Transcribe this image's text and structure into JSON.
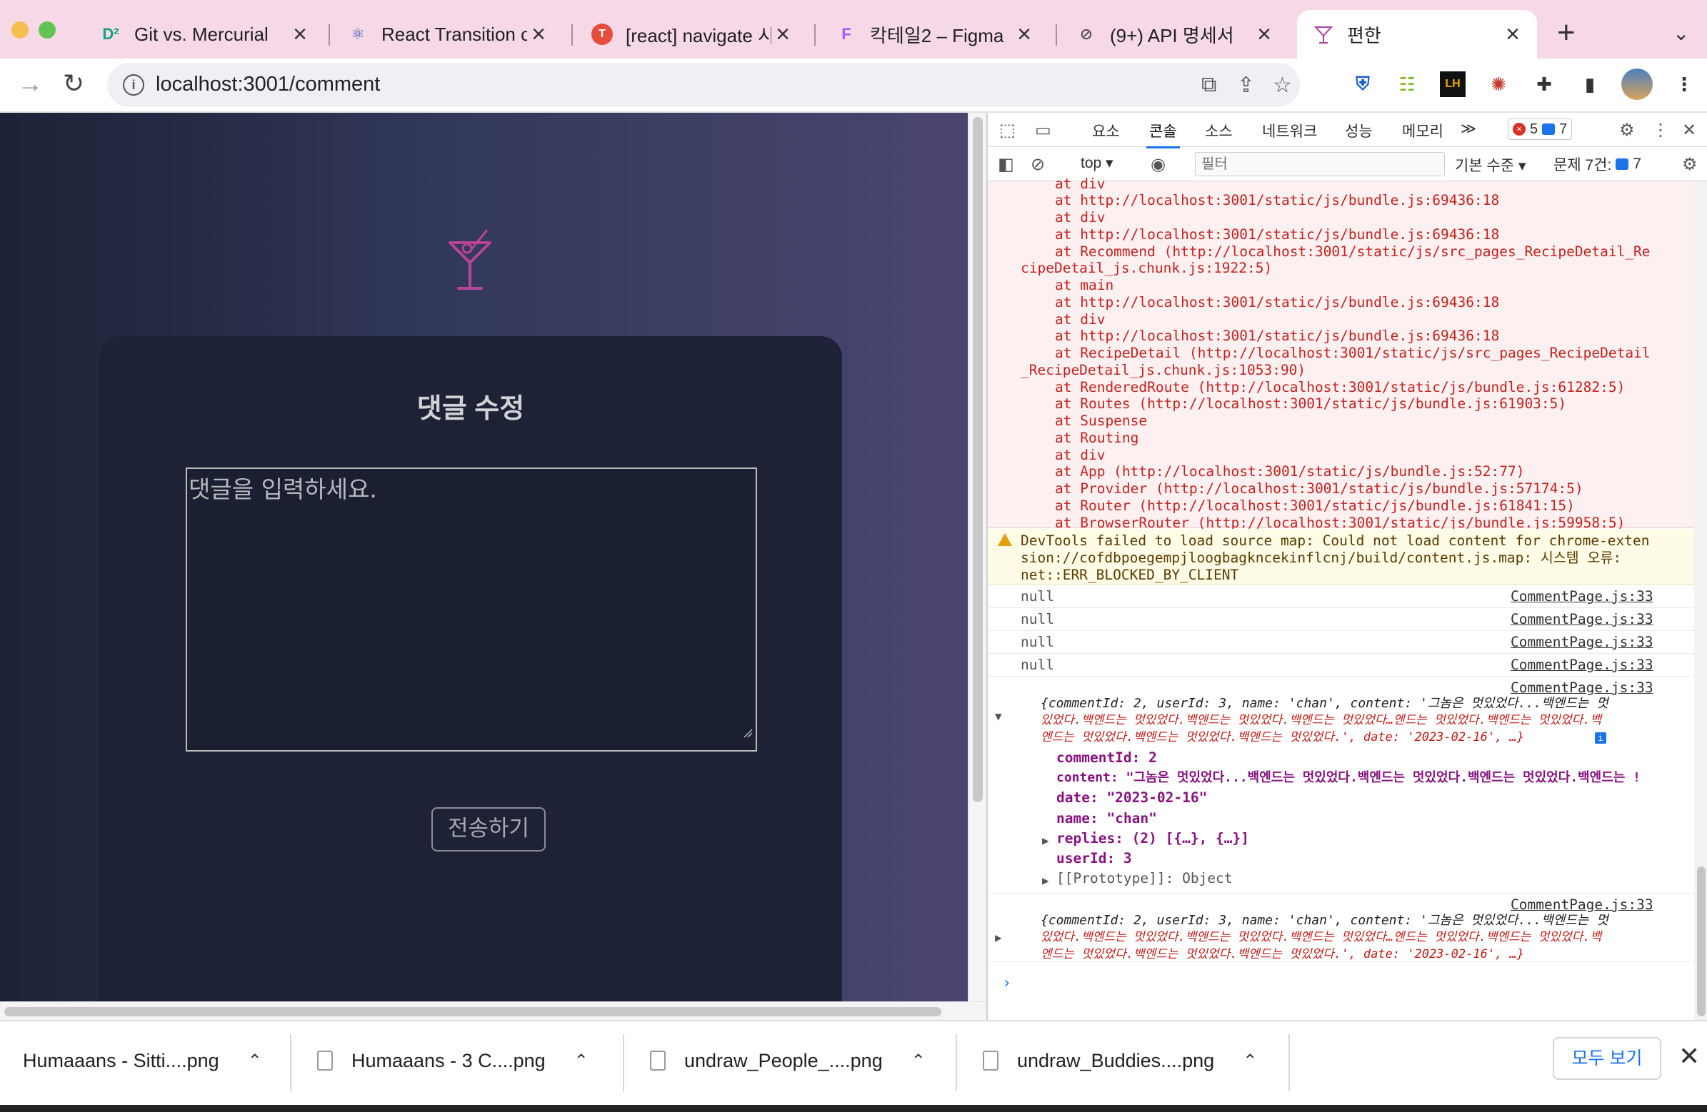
{
  "browser": {
    "tabs": [
      {
        "title": "Git vs. Mercurial",
        "favicon": "D²",
        "favicon_color": "#0fa37f"
      },
      {
        "title": "React Transition co",
        "favicon": "⚛",
        "favicon_color": "#3f51b5"
      },
      {
        "title": "[react] navigate 시",
        "favicon": "T",
        "favicon_color": "#e74c3c"
      },
      {
        "title": "칵테일2 – Figma",
        "favicon": "F",
        "favicon_color": "#a259ff"
      },
      {
        "title": "(9+) API 명세서",
        "favicon": "⊘",
        "favicon_color": "#555555"
      },
      {
        "title": "편한",
        "favicon": "🍸",
        "favicon_color": "#b040a0"
      }
    ],
    "url": "localhost:3001/comment"
  },
  "page": {
    "heading": "댓글 수정",
    "comment_placeholder": "댓글을 입력하세요.",
    "submit_label": "전송하기",
    "accent_color": "#b8449a"
  },
  "devtools": {
    "tabs": [
      "요소",
      "콘솔",
      "소스",
      "네트워크",
      "성능",
      "메모리"
    ],
    "more": "≫",
    "error_count": "5",
    "message_count": "7",
    "context": "top",
    "filter_placeholder": "필터",
    "level": "기본 수준 ▾",
    "issues_label": "문제 7건:",
    "issues_count": "7",
    "stack": [
      "at div",
      "at http://localhost:3001/static/js/bundle.js:69436:18",
      "at div",
      "at http://localhost:3001/static/js/bundle.js:69436:18",
      "at Recommend (http://localhost:3001/static/js/src_pages_RecipeDetail_Re",
      "cipeDetail_js.chunk.js:1922:5)",
      "at main",
      "at http://localhost:3001/static/js/bundle.js:69436:18",
      "at div",
      "at http://localhost:3001/static/js/bundle.js:69436:18",
      "at RecipeDetail (http://localhost:3001/static/js/src_pages_RecipeDetail",
      "_RecipeDetail_js.chunk.js:1053:90)",
      "at RenderedRoute (http://localhost:3001/static/js/bundle.js:61282:5)",
      "at Routes (http://localhost:3001/static/js/bundle.js:61903:5)",
      "at Suspense",
      "at Routing",
      "at div",
      "at App (http://localhost:3001/static/js/bundle.js:52:77)",
      "at Provider (http://localhost:3001/static/js/bundle.js:57174:5)",
      "at Router (http://localhost:3001/static/js/bundle.js:61841:15)",
      "at BrowserRouter (http://localhost:3001/static/js/bundle.js:59958:5)"
    ],
    "warning": [
      "DevTools failed to load source map: Could not load content for chrome-exten",
      "sion://cofdbpoegempjloogbagkncekinflcnj/build/content.js.map: 시스템 오류:",
      "net::ERR_BLOCKED_BY_CLIENT"
    ],
    "null_logs": [
      "null",
      "null",
      "null",
      "null"
    ],
    "source": "CommentPage.js:33",
    "object_preview": [
      "{commentId: 2, userId: 3, name: 'chan', content: '그놈은 멋있었다...백엔드는 멋",
      "있었다.백엔드는 멋있었다.백엔드는 멋있었다.백엔드는 멋있었다…엔드는 멋있었다.백엔드는 멋있었다.백",
      "엔드는 멋있었다.백엔드는 멋있었다.백엔드는 멋있었다.', date: '2023-02-16', …}"
    ],
    "props": {
      "commentId": "commentId: 2",
      "content": "content: \"그놈은 멋있었다...백엔드는 멋있었다.백엔드는 멋있었다.백엔드는 멋있었다.백엔드는 !",
      "date": "date: \"2023-02-16\"",
      "name": "name: \"chan\"",
      "replies": "replies: (2) [{…}, {…}]",
      "userId": "userId: 3",
      "proto": "[[Prototype]]: Object"
    }
  },
  "downloads": {
    "items": [
      "Humaaans - Sitti....png",
      "Humaaans - 3 C....png",
      "undraw_People_....png",
      "undraw_Buddies....png"
    ],
    "show_all": "모두 보기"
  }
}
